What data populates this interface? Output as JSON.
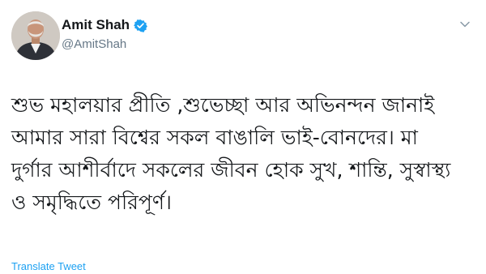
{
  "tweet": {
    "author": {
      "display_name": "Amit Shah",
      "handle": "@AmitShah",
      "verified": true,
      "avatar_icon": "profile-photo"
    },
    "menu_icon": "chevron-down-icon",
    "text": "শুভ মহালয়ার প্রীতি ,শুভেচ্ছা আর অভিনন্দন জানাই আমার সারা বিশ্বের সকল বাঙালি ভাই-বোনদের। মা দুর্গার আশীর্বাদে সকলের জীবন হোক সুখ, শান্তি, সুস্বাস্থ্য ও সমৃদ্ধিতে পরিপূর্ণ।",
    "translate_label": "Translate Tweet"
  },
  "colors": {
    "verified_blue": "#1da1f2",
    "link_blue": "#1da1f2",
    "secondary_text": "#657786",
    "primary_text": "#14171a"
  }
}
